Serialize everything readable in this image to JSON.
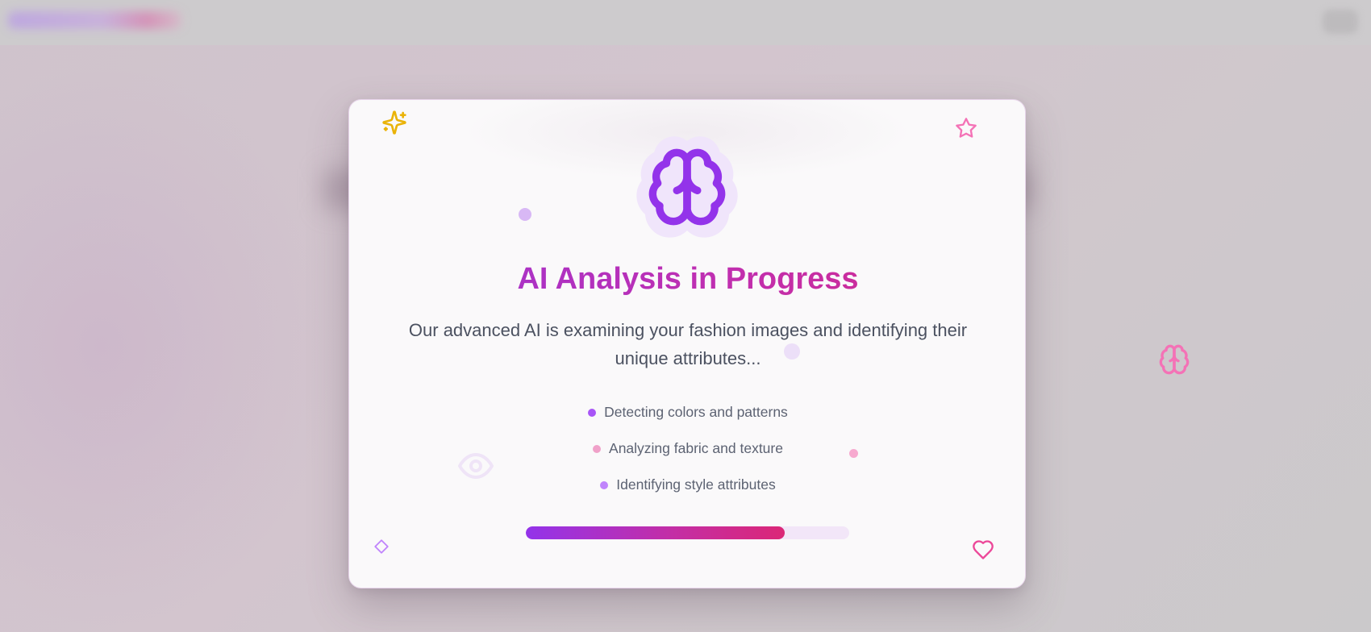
{
  "modal": {
    "title": "AI Analysis in Progress",
    "subtitle": "Our advanced AI is examining your fashion images and identifying their unique attributes...",
    "steps": [
      {
        "label": "Detecting colors and patterns",
        "bullet_color": "#a855f7"
      },
      {
        "label": "Analyzing fabric and texture",
        "bullet_color": "#f0a1c9"
      },
      {
        "label": "Identifying style attributes",
        "bullet_color": "#c084fc"
      }
    ],
    "progress": {
      "fraction": 0.8
    }
  },
  "icons": {
    "main": "brain-icon",
    "decor": [
      "sparkles-icon",
      "star-icon",
      "diamond-icon",
      "heart-icon",
      "eye-icon",
      "brain-icon"
    ]
  },
  "colors": {
    "accent_purple": "#9333ea",
    "accent_pink": "#db2777",
    "sparkle_yellow": "#eab308"
  }
}
